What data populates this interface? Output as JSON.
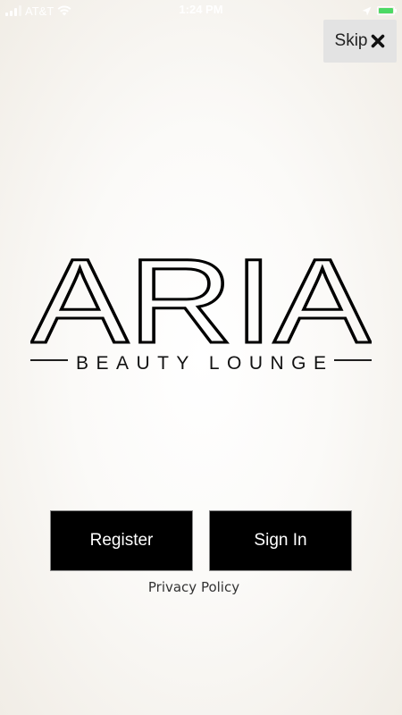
{
  "status_bar": {
    "carrier": "AT&T",
    "time": "1:24 PM",
    "icons": [
      "signal-icon",
      "wifi-icon",
      "location-arrow-icon",
      "battery-charging-icon"
    ],
    "battery_color": "#4cd964"
  },
  "skip": {
    "label": "Skip",
    "icon": "close-icon"
  },
  "logo": {
    "main": "ARIA",
    "tagline": "BEAUTY LOUNGE"
  },
  "actions": {
    "register_label": "Register",
    "signin_label": "Sign In"
  },
  "privacy_label": "Privacy Policy",
  "colors": {
    "button_bg": "#000000",
    "button_text": "#ffffff",
    "skip_bg": "#e3e3e3"
  }
}
